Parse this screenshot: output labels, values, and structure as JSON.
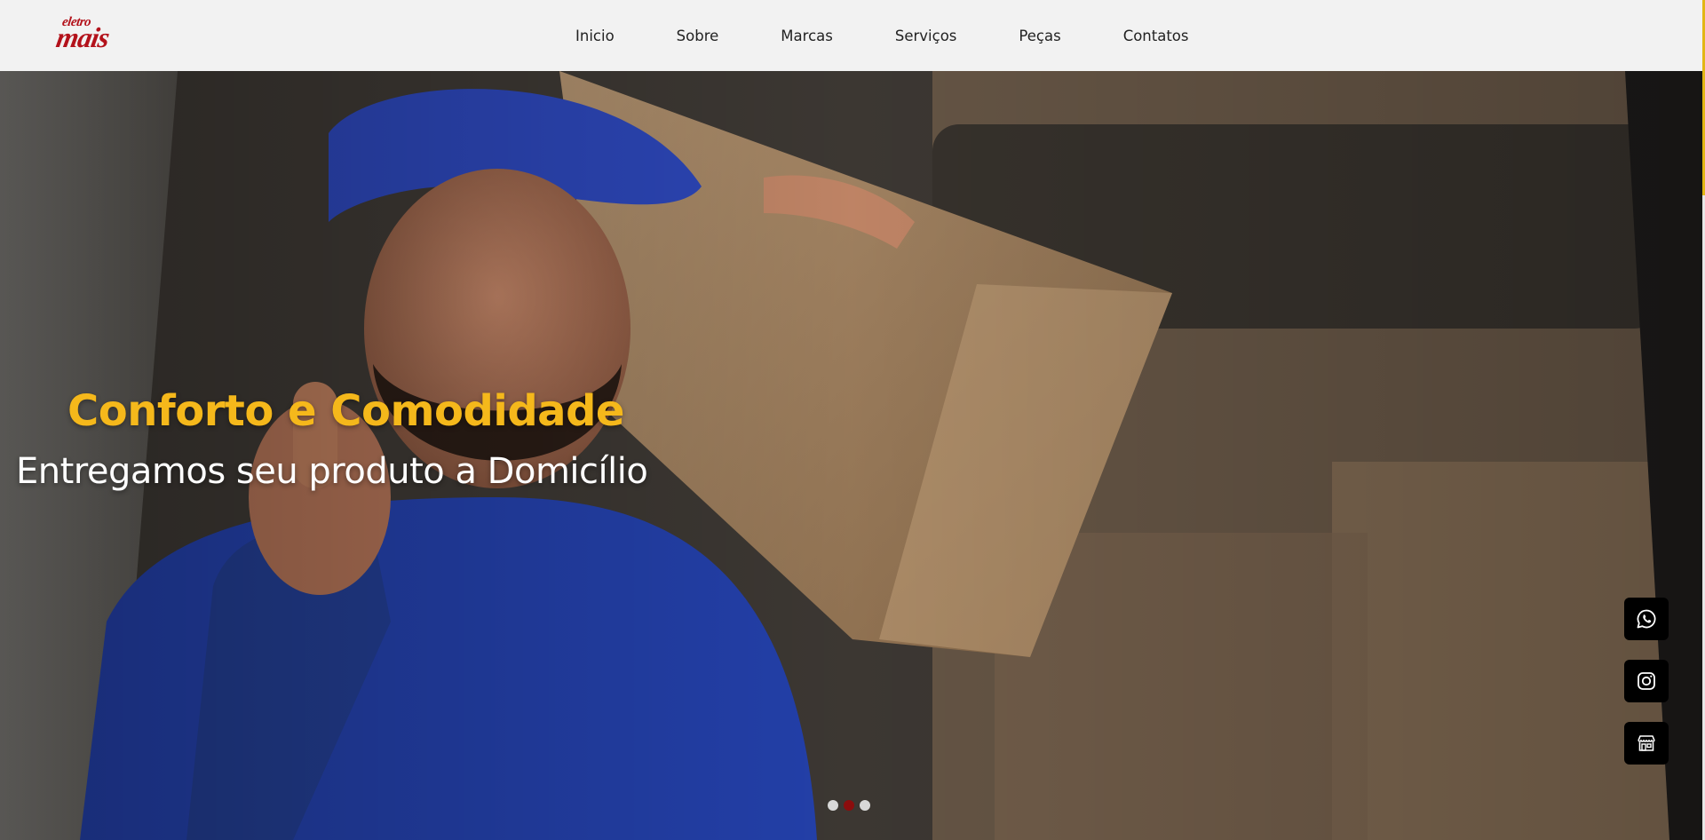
{
  "brand": {
    "logo_top": "eletro",
    "logo_bottom": "mais",
    "logo_color": "#b3121b"
  },
  "nav": {
    "items": [
      {
        "label": "Inicio"
      },
      {
        "label": "Sobre"
      },
      {
        "label": "Marcas"
      },
      {
        "label": "Serviços"
      },
      {
        "label": "Peças"
      },
      {
        "label": "Contatos"
      }
    ]
  },
  "hero": {
    "title": "Conforto e Comodidade",
    "subtitle": "Entregamos seu produto a Domicílio",
    "title_color": "#f5b81b",
    "carousel": {
      "slides": 3,
      "active_index": 1,
      "active_color": "#8b0d0d"
    }
  },
  "social": {
    "items": [
      {
        "name": "whatsapp-icon"
      },
      {
        "name": "instagram-icon"
      },
      {
        "name": "store-icon"
      }
    ]
  },
  "colors": {
    "accent": "#e2b616",
    "header_bg": "#f2f2f2"
  }
}
